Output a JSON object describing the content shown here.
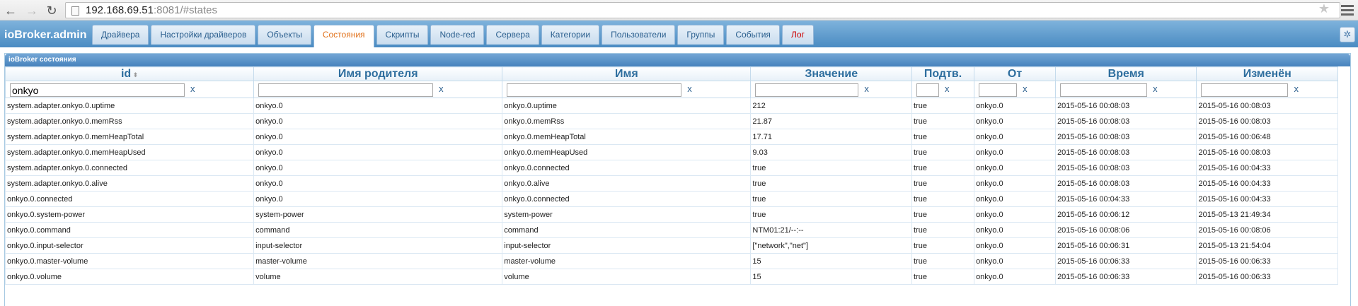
{
  "browser": {
    "url_host": "192.168.69.51",
    "url_rest": ":8081/#states"
  },
  "app": {
    "brand": "ioBroker.admin",
    "tabs": [
      {
        "label": "Драйвера"
      },
      {
        "label": "Настройки драйверов"
      },
      {
        "label": "Объекты"
      },
      {
        "label": "Состояния"
      },
      {
        "label": "Скрипты"
      },
      {
        "label": "Node-red"
      },
      {
        "label": "Сервера"
      },
      {
        "label": "Категории"
      },
      {
        "label": "Пользователи"
      },
      {
        "label": "Группы"
      },
      {
        "label": "События"
      },
      {
        "label": "Лог"
      }
    ],
    "active_tab": "Состояния"
  },
  "panel": {
    "title": "ioBroker состояния"
  },
  "table": {
    "columns": [
      "id",
      "Имя родителя",
      "Имя",
      "Значение",
      "Подтв.",
      "От",
      "Время",
      "Изменён"
    ],
    "filters": [
      "onkyo",
      "",
      "",
      "",
      "",
      "",
      "",
      ""
    ],
    "clear_label": "x",
    "rows": [
      [
        "system.adapter.onkyo.0.uptime",
        "onkyo.0",
        "onkyo.0.uptime",
        "212",
        "true",
        "onkyo.0",
        "2015-05-16 00:08:03",
        "2015-05-16 00:08:03"
      ],
      [
        "system.adapter.onkyo.0.memRss",
        "onkyo.0",
        "onkyo.0.memRss",
        "21.87",
        "true",
        "onkyo.0",
        "2015-05-16 00:08:03",
        "2015-05-16 00:08:03"
      ],
      [
        "system.adapter.onkyo.0.memHeapTotal",
        "onkyo.0",
        "onkyo.0.memHeapTotal",
        "17.71",
        "true",
        "onkyo.0",
        "2015-05-16 00:08:03",
        "2015-05-16 00:06:48"
      ],
      [
        "system.adapter.onkyo.0.memHeapUsed",
        "onkyo.0",
        "onkyo.0.memHeapUsed",
        "9.03",
        "true",
        "onkyo.0",
        "2015-05-16 00:08:03",
        "2015-05-16 00:08:03"
      ],
      [
        "system.adapter.onkyo.0.connected",
        "onkyo.0",
        "onkyo.0.connected",
        "true",
        "true",
        "onkyo.0",
        "2015-05-16 00:08:03",
        "2015-05-16 00:04:33"
      ],
      [
        "system.adapter.onkyo.0.alive",
        "onkyo.0",
        "onkyo.0.alive",
        "true",
        "true",
        "onkyo.0",
        "2015-05-16 00:08:03",
        "2015-05-16 00:04:33"
      ],
      [
        "onkyo.0.connected",
        "onkyo.0",
        "onkyo.0.connected",
        "true",
        "true",
        "onkyo.0",
        "2015-05-16 00:04:33",
        "2015-05-16 00:04:33"
      ],
      [
        "onkyo.0.system-power",
        "system-power",
        "system-power",
        "true",
        "true",
        "onkyo.0",
        "2015-05-16 00:06:12",
        "2015-05-13 21:49:34"
      ],
      [
        "onkyo.0.command",
        "command",
        "command",
        "NTM01:21/--:--",
        "true",
        "onkyo.0",
        "2015-05-16 00:08:06",
        "2015-05-16 00:08:06"
      ],
      [
        "onkyo.0.input-selector",
        "input-selector",
        "input-selector",
        "[\"network\",\"net\"]",
        "true",
        "onkyo.0",
        "2015-05-16 00:06:31",
        "2015-05-13 21:54:04"
      ],
      [
        "onkyo.0.master-volume",
        "master-volume",
        "master-volume",
        "15",
        "true",
        "onkyo.0",
        "2015-05-16 00:06:33",
        "2015-05-16 00:06:33"
      ],
      [
        "onkyo.0.volume",
        "volume",
        "volume",
        "15",
        "true",
        "onkyo.0",
        "2015-05-16 00:06:33",
        "2015-05-16 00:06:33"
      ]
    ]
  }
}
